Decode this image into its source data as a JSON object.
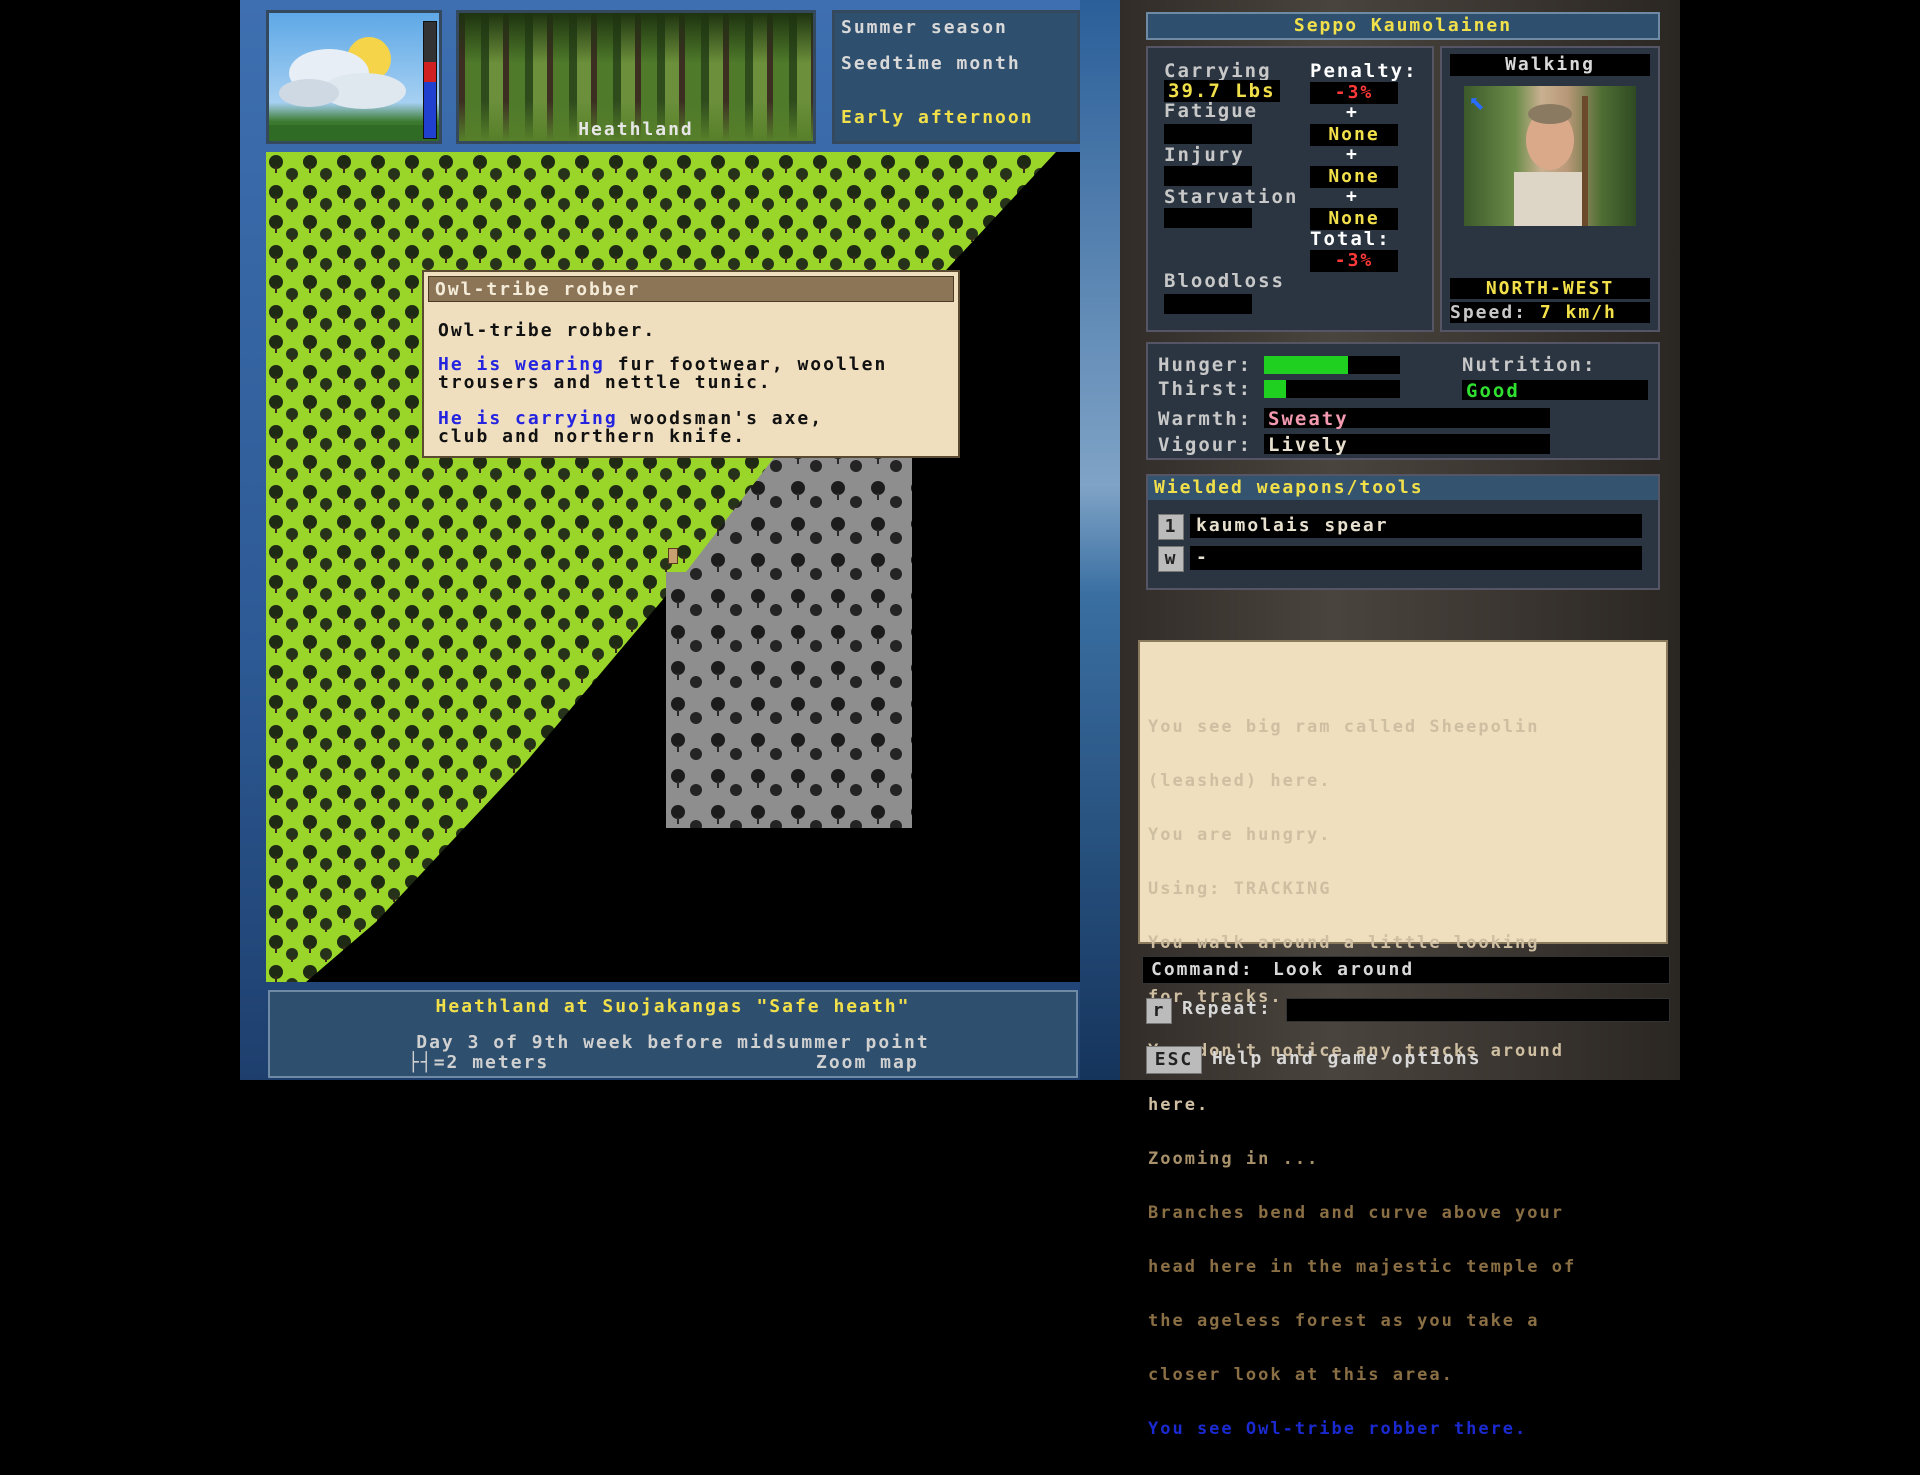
{
  "season": {
    "line1": "Summer season",
    "line2": "Seedtime month",
    "line3": "Early afternoon"
  },
  "terrain_label": "Heathland",
  "tooltip": {
    "title": "Owl-tribe robber",
    "body": "Owl-tribe robber.",
    "wearing_prefix": "He is wearing",
    "wearing_text": " fur footwear, woollen",
    "wearing_text2": "trousers and nettle tunic.",
    "carrying_prefix": "He is carrying",
    "carrying_text": " woodsman's axe,",
    "carrying_text2": "club and northern knife."
  },
  "map_footer": {
    "location": "Heathland at Suojakangas \"Safe heath\"",
    "date": "Day 3 of 9th week before midsummer point",
    "scale": "=2 meters",
    "zoom": "Zoom map"
  },
  "character": {
    "name": "Seppo Kaumolainen",
    "carrying_label": "Carrying",
    "carrying_value": "39.7 Lbs",
    "penalty_label": "Penalty:",
    "penalty_value": "-3%",
    "fatigue_label": "Fatigue",
    "fatigue_value": "None",
    "injury_label": "Injury",
    "injury_value": "None",
    "starvation_label": "Starvation",
    "starvation_value": "None",
    "total_label": "Total:",
    "total_value": "-3%",
    "bloodloss_label": "Bloodloss",
    "plus": "+",
    "movement": "Walking",
    "direction": "NORTH-WEST",
    "speed_label": "Speed:",
    "speed_value": "7 km/h"
  },
  "needs": {
    "hunger_label": "Hunger:",
    "hunger_level": 0.62,
    "thirst_label": "Thirst:",
    "thirst_level": 0.16,
    "nutrition_label": "Nutrition:",
    "nutrition_value": "Good",
    "warmth_label": "Warmth:",
    "warmth_value": "Sweaty",
    "vigour_label": "Vigour:",
    "vigour_value": "Lively"
  },
  "weapons": {
    "title": "Wielded weapons/tools",
    "slot1_key": "1",
    "slot1_value": "kaumolais spear",
    "slot2_key": "w",
    "slot2_value": "-"
  },
  "log": [
    "You see big ram called Sheepolin",
    "(leashed) here.",
    "You are hungry.",
    "Using: TRACKING",
    "You walk around a little looking",
    "for tracks...",
    "You don't notice any tracks around",
    "here.",
    "Zooming in ...",
    "Branches bend and curve above your",
    "head here in the majestic temple of",
    "the ageless forest as you take a",
    "closer look at this area."
  ],
  "log_last": "You see Owl-tribe robber there.",
  "command": {
    "label": "Command:",
    "value": "Look around"
  },
  "repeat": {
    "key": "r",
    "label": "Repeat:"
  },
  "help": {
    "key": "ESC",
    "label": "Help and game options"
  },
  "colors": {
    "grass": "#9ad62a",
    "fog": "#8c8c8c",
    "parchment": "#f0dfbe",
    "panel": "#2e4f6e"
  }
}
